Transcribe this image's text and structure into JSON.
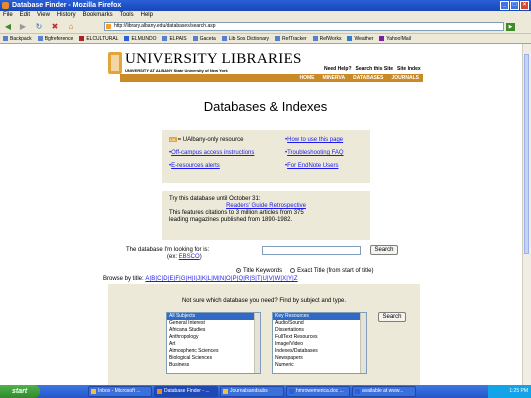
{
  "window": {
    "title": "Database Finder - Mozilla Firefox"
  },
  "menu": [
    "File",
    "Edit",
    "View",
    "History",
    "Bookmarks",
    "Tools",
    "Help"
  ],
  "address": {
    "url": "http://library.albany.edu/databases/search.asp"
  },
  "bookmarks": [
    "Backpack",
    "Bgfreference",
    "ELCULTURAL",
    "ELMUNDO",
    "ELPAIS",
    "Gaceta",
    "Lib Sos Dictionary",
    "RefTracker",
    "RefWorks",
    "Weather",
    "Yahoo!Mail"
  ],
  "header": {
    "library_name": "UNIVERSITY LIBRARIES",
    "library_sub": "UNIVERSITY AT ALBANY State University of New York",
    "help_links": [
      "Need Help?",
      "Search this Site",
      "Site Index"
    ],
    "nav": [
      "HOME",
      "MINERVA",
      "DATABASES",
      "JOURNALS"
    ]
  },
  "page_title": "Databases & Indexes",
  "info": {
    "ua_badge": "UA",
    "ua_only": "= UAlbany-only resource",
    "how_to": "How to use this page",
    "offcampus": "Off-campus access instructions",
    "troubleshooting": "Troubleshooting FAQ",
    "alerts": "E-resources alerts",
    "endnote": "For EndNote Users"
  },
  "trial": {
    "line1": "Try this database until October 31:",
    "link": "Readers' Guide Retrospective",
    "line2": "This features citations to 3 million articles from 375",
    "line3": "leading magazines published from 1890-1982."
  },
  "search": {
    "label": "The database I'm looking for is:",
    "example_prefix": "(ex: ",
    "example_link": "EBSCO",
    "example_suffix": ")",
    "value": "",
    "button": "Search",
    "radio_keywords": "Title Keywords",
    "radio_exact": "Exact Title (from start of title)",
    "browse_label": "Browse by title:",
    "letters": "A|B|C|D|E|F|G|H|I|J|K|L|M|N|O|P|Q|R|S|T|U|V|W|X|Y|Z"
  },
  "subject": {
    "prompt": "Not sure which database you need? Find by subject and type.",
    "subjects": [
      "All Subjects",
      "General Interest",
      "Africana Studies",
      "Anthropology",
      "Art",
      "Atmospheric Sciences",
      "Biological Sciences",
      "Business"
    ],
    "types": [
      "Key Resources",
      "Audio/Sound",
      "Dissertations",
      "FullText Resources",
      "Image/Video",
      "Indexes/Databases",
      "Newspapers",
      "Numeric"
    ],
    "button": "Search"
  },
  "taskbar": {
    "start": "start",
    "tasks": [
      "Inbox - Microsoft ...",
      "Database Finder - ...",
      "Journalsandsubs",
      "hmrowemerica.doc ...",
      "available at www..."
    ],
    "clock": "1:25 PM"
  }
}
